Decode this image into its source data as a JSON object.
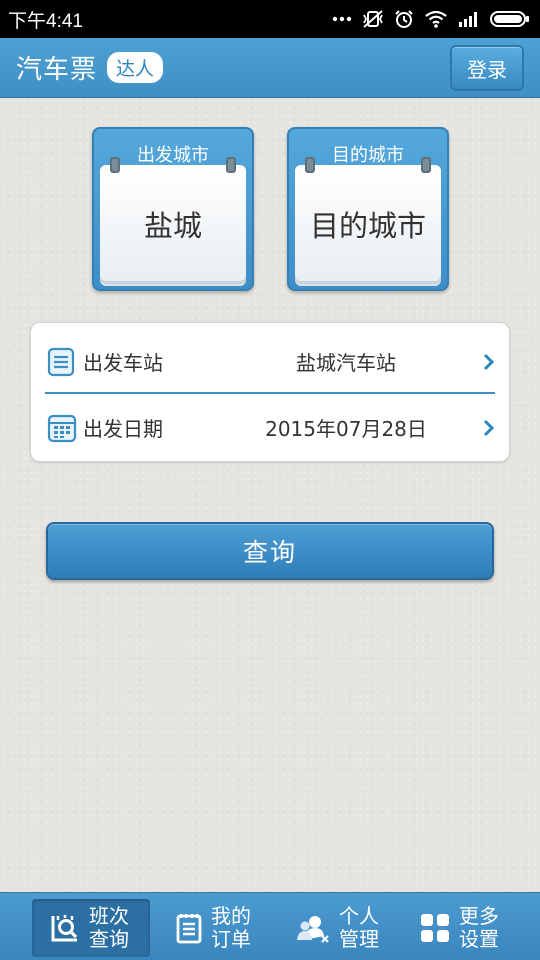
{
  "status_bar": {
    "time": "下午4:41"
  },
  "header": {
    "title": "汽车票",
    "badge": "达人",
    "login_label": "登录"
  },
  "cities": {
    "from": {
      "label": "出发城市",
      "value": "盐城"
    },
    "to": {
      "label": "目的城市",
      "value": "目的城市"
    }
  },
  "form": {
    "station": {
      "label": "出发车站",
      "value": "盐城汽车站"
    },
    "date": {
      "label": "出发日期",
      "value": "2015年07月28日"
    }
  },
  "search_label": "查询",
  "nav": [
    {
      "label": "班次查询",
      "icon": "bus-search-icon",
      "active": true
    },
    {
      "label": "我的订单",
      "icon": "order-list-icon",
      "active": false
    },
    {
      "label": "个人管理",
      "icon": "user-manage-icon",
      "active": false
    },
    {
      "label": "更多设置",
      "icon": "grid-settings-icon",
      "active": false
    }
  ],
  "colors": {
    "primary": "#3f8fc4",
    "accent_dark": "#2b6fa3",
    "background": "#e6e4df"
  }
}
